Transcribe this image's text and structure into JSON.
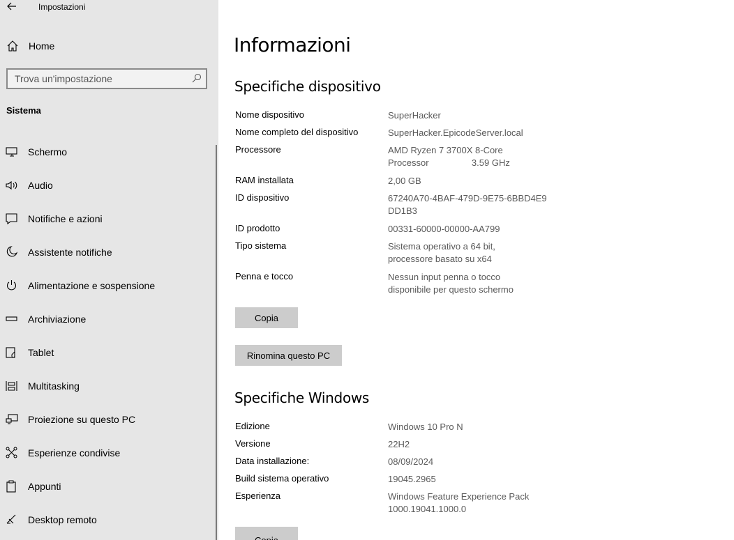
{
  "window": {
    "title": "Impostazioni"
  },
  "sidebar": {
    "home_label": "Home",
    "search_placeholder": "Trova un'impostazione",
    "section_label": "Sistema",
    "items": [
      {
        "label": "Schermo",
        "icon": "monitor-icon"
      },
      {
        "label": "Audio",
        "icon": "speaker-icon"
      },
      {
        "label": "Notifiche e azioni",
        "icon": "notification-icon"
      },
      {
        "label": "Assistente notifiche",
        "icon": "moon-icon"
      },
      {
        "label": "Alimentazione e sospensione",
        "icon": "power-icon"
      },
      {
        "label": "Archiviazione",
        "icon": "storage-icon"
      },
      {
        "label": "Tablet",
        "icon": "tablet-icon"
      },
      {
        "label": "Multitasking",
        "icon": "multitasking-icon"
      },
      {
        "label": "Proiezione su questo PC",
        "icon": "projection-icon"
      },
      {
        "label": "Esperienze condivise",
        "icon": "shared-icon"
      },
      {
        "label": "Appunti",
        "icon": "clipboard-icon"
      },
      {
        "label": "Desktop remoto",
        "icon": "remote-desktop-icon"
      }
    ]
  },
  "main": {
    "title": "Informazioni",
    "device_specs": {
      "heading": "Specifiche dispositivo",
      "rows": [
        {
          "key": "Nome dispositivo",
          "value": "SuperHacker"
        },
        {
          "key": "Nome completo del dispositivo",
          "value": "SuperHacker.EpicodeServer.local"
        },
        {
          "key": "Processore",
          "value": "AMD Ryzen 7 3700X 8-Core Processor                 3.59 GHz"
        },
        {
          "key": "RAM installata",
          "value": "2,00 GB"
        },
        {
          "key": "ID dispositivo",
          "value": "67240A70-4BAF-479D-9E75-6BBD4E9DD1B3"
        },
        {
          "key": "ID prodotto",
          "value": "00331-60000-00000-AA799"
        },
        {
          "key": "Tipo sistema",
          "value": "Sistema operativo a 64 bit, processore basato su x64"
        },
        {
          "key": "Penna e tocco",
          "value": "Nessun input penna o tocco disponibile per questo schermo"
        }
      ],
      "copy_label": "Copia",
      "rename_label": "Rinomina questo PC"
    },
    "windows_specs": {
      "heading": "Specifiche Windows",
      "rows": [
        {
          "key": "Edizione",
          "value": "Windows 10 Pro N"
        },
        {
          "key": "Versione",
          "value": "22H2"
        },
        {
          "key": "Data installazione:",
          "value": "08/09/2024"
        },
        {
          "key": "Build sistema operativo",
          "value": "19045.2965"
        },
        {
          "key": "Esperienza",
          "value": "Windows Feature Experience Pack 1000.19041.1000.0"
        }
      ],
      "copy_label": "Copia"
    }
  }
}
